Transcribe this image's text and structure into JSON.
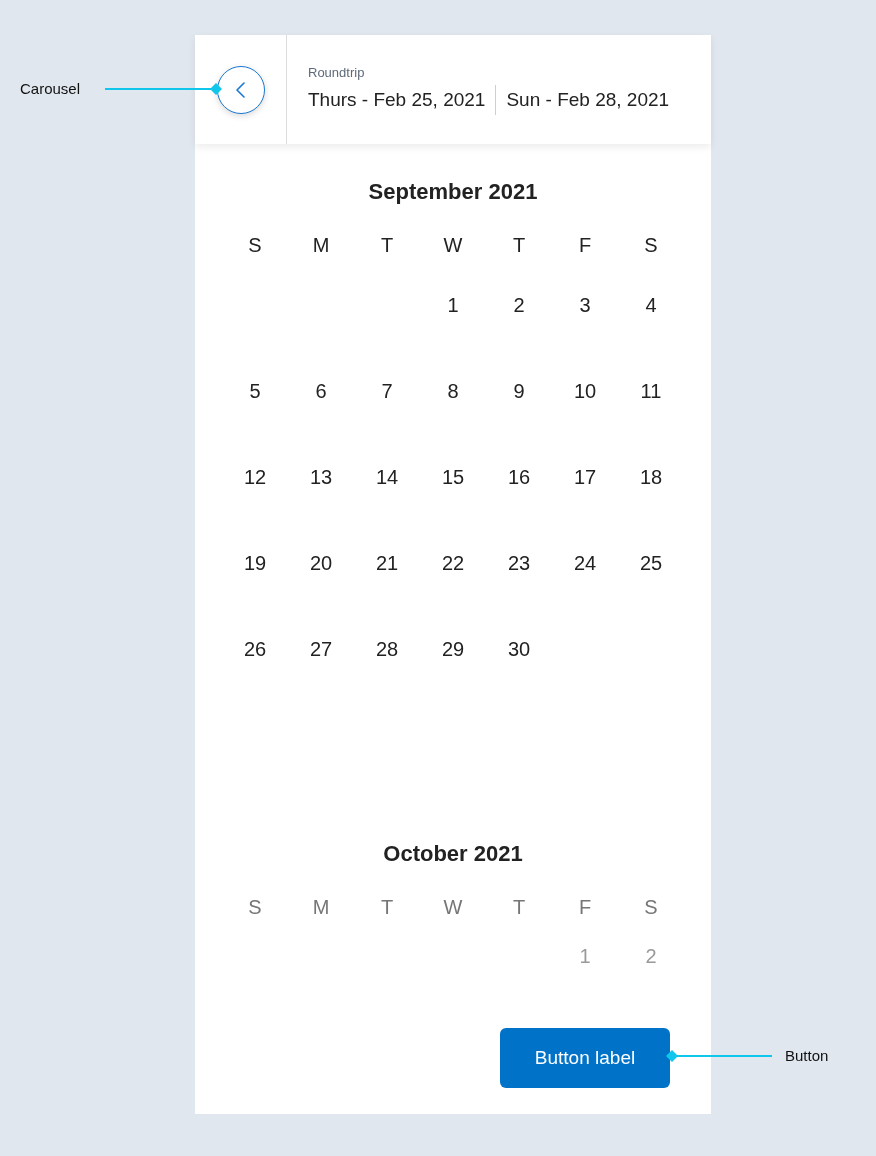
{
  "header": {
    "trip_type": "Roundtrip",
    "departure": "Thurs - Feb 25, 2021",
    "return": "Sun - Feb 28, 2021",
    "annotation": "Carousel"
  },
  "months": [
    {
      "title": "September 2021",
      "faded": false,
      "weekdays": [
        "S",
        "M",
        "T",
        "W",
        "T",
        "F",
        "S"
      ],
      "weeks": [
        {
          "padded_start": true,
          "days": [
            "1",
            "2",
            "3",
            "4"
          ]
        },
        {
          "padded_start": false,
          "days": [
            "5",
            "6",
            "7",
            "8",
            "9",
            "10",
            "11"
          ]
        },
        {
          "padded_start": false,
          "days": [
            "12",
            "13",
            "14",
            "15",
            "16",
            "17",
            "18"
          ]
        },
        {
          "padded_start": false,
          "days": [
            "19",
            "20",
            "21",
            "22",
            "23",
            "24",
            "25"
          ]
        },
        {
          "padded_start": false,
          "days": [
            "26",
            "27",
            "28",
            "29",
            "30"
          ]
        }
      ]
    },
    {
      "title": "October 2021",
      "faded": true,
      "weekdays": [
        "S",
        "M",
        "T",
        "W",
        "T",
        "F",
        "S"
      ],
      "weeks": [
        {
          "padded_start": true,
          "days": [
            "1",
            "2"
          ]
        }
      ]
    }
  ],
  "button": {
    "label": "Button label",
    "annotation": "Button"
  }
}
